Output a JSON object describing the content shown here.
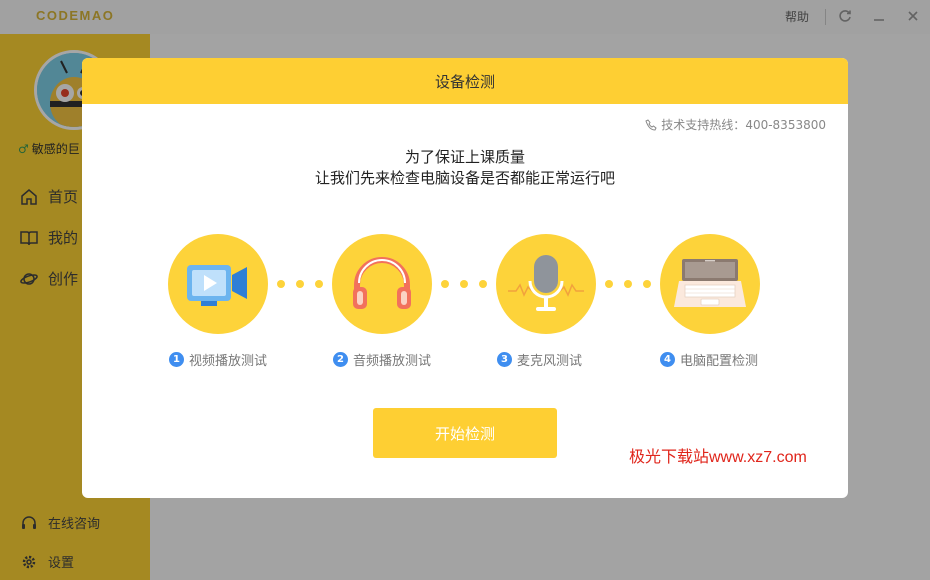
{
  "app": {
    "logo": "CODEMAO",
    "help_label": "帮助"
  },
  "sidebar": {
    "username": "敏感的巨",
    "nav": [
      {
        "label": "首页",
        "icon": "home-icon"
      },
      {
        "label": "我的",
        "icon": "book-icon"
      },
      {
        "label": "创作",
        "icon": "planet-icon"
      }
    ],
    "bottom": [
      {
        "label": "在线咨询",
        "icon": "headset-icon"
      },
      {
        "label": "设置",
        "icon": "gear-icon"
      }
    ]
  },
  "modal": {
    "title": "设备检测",
    "hotline_label": "技术支持热线：",
    "hotline_number": "400-8353800",
    "intro_line1": "为了保证上课质量",
    "intro_line2": "让我们先来检查电脑设备是否都能正常运行吧",
    "steps": [
      {
        "num": "1",
        "label": "视频播放测试",
        "icon": "video-camera-icon"
      },
      {
        "num": "2",
        "label": "音频播放测试",
        "icon": "headphones-icon"
      },
      {
        "num": "3",
        "label": "麦克风测试",
        "icon": "microphone-icon"
      },
      {
        "num": "4",
        "label": "电脑配置检测",
        "icon": "laptop-icon"
      }
    ],
    "start_button": "开始检测"
  },
  "watermark": "极光下载站www.xz7.com",
  "colors": {
    "accent": "#fecf33",
    "step_number": "#3f8ef0",
    "watermark": "#e0251b"
  }
}
